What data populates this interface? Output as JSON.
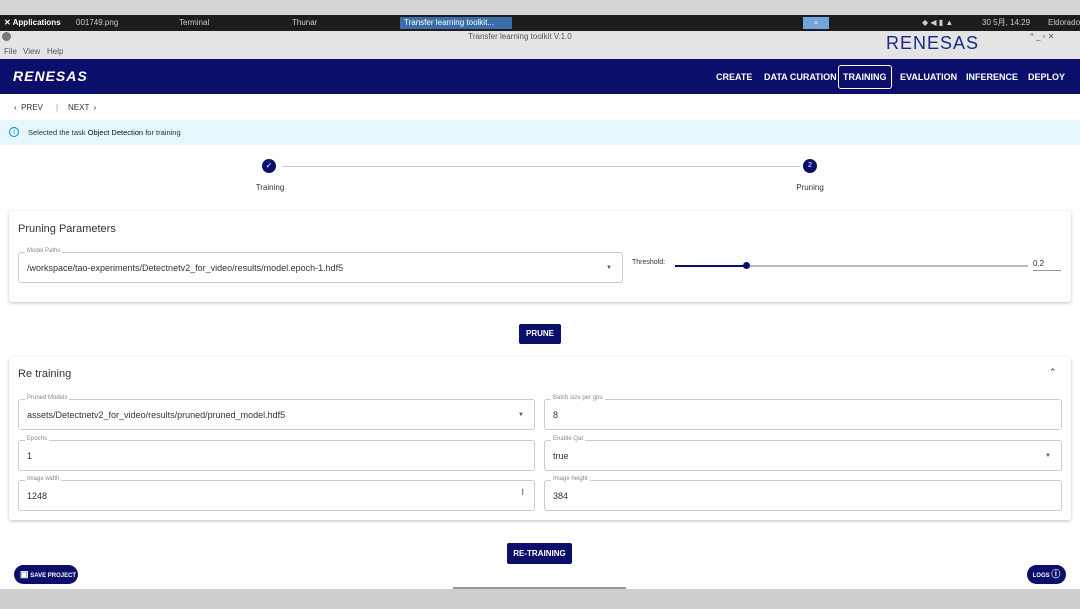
{
  "os": {
    "apps_label": "Applications",
    "tasks": [
      "001749.png",
      "Terminal",
      "Thunar",
      "Transfer learning toolkit..."
    ],
    "clock": "30 5月, 14:29",
    "user": "Eldorado"
  },
  "window": {
    "title": "Transfer learning toolkit V.1.0",
    "menu": [
      "File",
      "View",
      "Help"
    ],
    "brand": "RENESAS"
  },
  "nav": {
    "logo": "RENESAS",
    "items": [
      "CREATE",
      "DATA CURATION",
      "TRAINING",
      "EVALUATION",
      "INFERENCE",
      "DEPLOY"
    ],
    "active": "TRAINING"
  },
  "pager": {
    "prev": "PREV",
    "next": "NEXT"
  },
  "info": {
    "prefix": "Selected the task",
    "task": "Object Detection",
    "suffix": "for training"
  },
  "stepper": {
    "steps": [
      {
        "label": "Training",
        "state": "done"
      },
      {
        "label": "Pruning",
        "number": "2",
        "state": "active"
      }
    ]
  },
  "pruning": {
    "title": "Pruning Parameters",
    "model_paths_label": "Model Paths",
    "model_path": "/workspace/tao-experiments/Detectnetv2_for_video/results/model.epoch-1.hdf5",
    "threshold_label": "Threshold:",
    "threshold": "0.2",
    "button": "PRUNE"
  },
  "retraining": {
    "title": "Re training",
    "pruned_models_label": "Pruned Models",
    "pruned_model": "assets/Detectnetv2_for_video/results/pruned/pruned_model.hdf5",
    "batch_label": "Batch size per gpu",
    "batch": "8",
    "epochs_label": "Epochs",
    "epochs": "1",
    "qat_label": "Enable Qat",
    "qat": "true",
    "width_label": "Image width",
    "width": "1248",
    "height_label": "Image height",
    "height": "384",
    "button": "RE-TRAINING"
  },
  "footer": {
    "save": "SAVE PROJECT",
    "logs": "LOGS"
  },
  "colors": {
    "brand": "#0b0f6b",
    "info_bg": "#e5f6fd"
  }
}
